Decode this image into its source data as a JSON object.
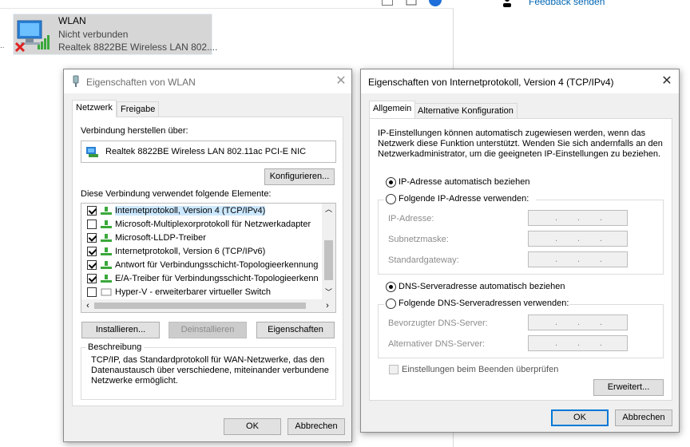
{
  "background": {
    "feedback_link": "Feedback senden",
    "wlan_card": {
      "title": "WLAN",
      "status": "Nicht verbunden",
      "adapter": "Realtek 8822BE Wireless LAN 802...."
    },
    "dots": ".."
  },
  "wlan_props": {
    "title": "Eigenschaften von WLAN",
    "tabs": [
      "Netzwerk",
      "Freigabe"
    ],
    "connect_via_label": "Verbindung herstellen über:",
    "adapter_name": "Realtek 8822BE Wireless LAN 802.11ac PCI-E NIC",
    "configure_button": "Konfigurieren...",
    "elements_label": "Diese Verbindung verwendet folgende Elemente:",
    "items": [
      {
        "label": "Internetprotokoll, Version 4 (TCP/IPv4)",
        "checked": true,
        "selected": true
      },
      {
        "label": "Microsoft-Multiplexorprotokoll für Netzwerkadapter",
        "checked": false,
        "selected": false
      },
      {
        "label": "Microsoft-LLDP-Treiber",
        "checked": true,
        "selected": false
      },
      {
        "label": "Internetprotokoll, Version 6 (TCP/IPv6)",
        "checked": true,
        "selected": false
      },
      {
        "label": "Antwort für Verbindungsschicht-Topologieerkennung",
        "checked": true,
        "selected": false
      },
      {
        "label": "E/A-Treiber für Verbindungsschicht-Topologieerkennung",
        "checked": true,
        "selected": false
      },
      {
        "label": "Hyper-V - erweiterbarer virtueller Switch",
        "checked": false,
        "selected": false
      }
    ],
    "install_button": "Installieren...",
    "uninstall_button": "Deinstallieren",
    "properties_button": "Eigenschaften",
    "description_label": "Beschreibung",
    "description_text": [
      "TCP/IP, das Standardprotokoll für WAN-Netzwerke, das den",
      "Datenaustausch über verschiedene, miteinander verbundene",
      "Netzwerke ermöglicht."
    ],
    "ok_button": "OK",
    "cancel_button": "Abbrechen"
  },
  "ipv4_props": {
    "title": "Eigenschaften von Internetprotokoll, Version 4 (TCP/IPv4)",
    "tabs": [
      "Allgemein",
      "Alternative Konfiguration"
    ],
    "intro": [
      "IP-Einstellungen können automatisch zugewiesen werden, wenn das",
      "Netzwerk diese Funktion unterstützt. Wenden Sie sich andernfalls an den",
      "Netzwerkadministrator, um die geeigneten IP-Einstellungen zu beziehen."
    ],
    "ip_auto": "IP-Adresse automatisch beziehen",
    "ip_manual": "Folgende IP-Adresse verwenden:",
    "ip_address_label": "IP-Adresse:",
    "subnet_label": "Subnetzmaske:",
    "gateway_label": "Standardgateway:",
    "dns_auto": "DNS-Serveradresse automatisch beziehen",
    "dns_manual": "Folgende DNS-Serveradressen verwenden:",
    "dns_pref_label": "Bevorzugter DNS-Server:",
    "dns_alt_label": "Alternativer DNS-Server:",
    "validate_label": "Einstellungen beim Beenden überprüfen",
    "advanced_button": "Erweitert...",
    "ok_button": "OK",
    "cancel_button": "Abbrechen",
    "ip_dot": "."
  }
}
